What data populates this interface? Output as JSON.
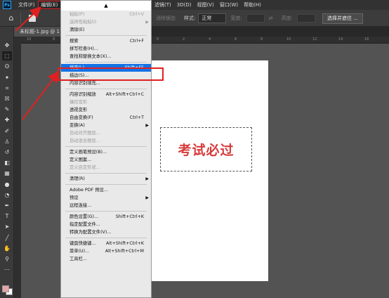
{
  "menubar": {
    "logo": "Ps",
    "items_left": [
      "文件(F)",
      "编辑(E)"
    ],
    "items_right": [
      "滤镜(T)",
      "3D(D)",
      "视图(V)",
      "窗口(W)",
      "帮助(H)"
    ]
  },
  "options": {
    "style_label": "样式:",
    "style_value": "正常",
    "width_label": "宽度:",
    "height_label": "高度:",
    "feather_label": "消除锯齿",
    "select_mask_button": "选择并遮住 ..."
  },
  "document": {
    "tab_title": "未标题-1.jpg @ 1"
  },
  "ruler_ticks": [
    "10",
    "8",
    "6",
    "4",
    "2",
    "0",
    "2",
    "4",
    "6",
    "8",
    "10",
    "12",
    "14",
    "16"
  ],
  "canvas": {
    "text": "考试必过"
  },
  "menu": {
    "top_glyph": "▲",
    "groups": [
      [
        {
          "label": "粘贴(P)",
          "shortcut": "Ctrl+V",
          "disabled": true
        },
        {
          "label": "选择性粘贴(I)",
          "shortcut": "",
          "disabled": true,
          "submenu": true
        },
        {
          "label": "清除(E)",
          "shortcut": "",
          "disabled": false
        }
      ],
      [
        {
          "label": "搜索",
          "shortcut": "Ctrl+F",
          "disabled": false
        },
        {
          "label": "拼写检查(H)...",
          "shortcut": "",
          "disabled": false
        },
        {
          "label": "查找和替换文本(X)...",
          "shortcut": "",
          "disabled": false
        }
      ],
      [
        {
          "label": "填充(L)...",
          "shortcut": "Shift+F5",
          "disabled": false,
          "active": true
        },
        {
          "label": "描边(S)...",
          "shortcut": "",
          "disabled": false
        },
        {
          "label": "内容识别填充...",
          "shortcut": "",
          "disabled": false
        }
      ],
      [
        {
          "label": "内容识别缩放",
          "shortcut": "Alt+Shift+Ctrl+C",
          "disabled": false
        },
        {
          "label": "操控变形",
          "shortcut": "",
          "disabled": true
        },
        {
          "label": "透视变形",
          "shortcut": "",
          "disabled": false
        },
        {
          "label": "自由变换(F)",
          "shortcut": "Ctrl+T",
          "disabled": false
        },
        {
          "label": "变换(A)",
          "shortcut": "",
          "disabled": false,
          "submenu": true
        },
        {
          "label": "自动对齐图层...",
          "shortcut": "",
          "disabled": true
        },
        {
          "label": "自动混合图层...",
          "shortcut": "",
          "disabled": true
        }
      ],
      [
        {
          "label": "定义画笔预设(B)...",
          "shortcut": "",
          "disabled": false
        },
        {
          "label": "定义图案...",
          "shortcut": "",
          "disabled": false
        },
        {
          "label": "定义自定形状...",
          "shortcut": "",
          "disabled": true
        }
      ],
      [
        {
          "label": "清理(R)",
          "shortcut": "",
          "disabled": false,
          "submenu": true
        }
      ],
      [
        {
          "label": "Adobe PDF 预设...",
          "shortcut": "",
          "disabled": false
        },
        {
          "label": "预设",
          "shortcut": "",
          "disabled": false,
          "submenu": true
        },
        {
          "label": "远程连接...",
          "shortcut": "",
          "disabled": false
        }
      ],
      [
        {
          "label": "颜色设置(G)...",
          "shortcut": "Shift+Ctrl+K",
          "disabled": false
        },
        {
          "label": "指定配置文件...",
          "shortcut": "",
          "disabled": false
        },
        {
          "label": "转换为配置文件(V)...",
          "shortcut": "",
          "disabled": false
        }
      ],
      [
        {
          "label": "键盘快捷键...",
          "shortcut": "Alt+Shift+Ctrl+K",
          "disabled": false
        },
        {
          "label": "菜单(U)...",
          "shortcut": "Alt+Shift+Ctrl+M",
          "disabled": false
        },
        {
          "label": "工具栏...",
          "shortcut": "",
          "disabled": false
        }
      ]
    ]
  },
  "tools": [
    "move-tool-icon",
    "marquee-tool-icon",
    "lasso-tool-icon",
    "magic-wand-icon",
    "crop-tool-icon",
    "frame-tool-icon",
    "eyedropper-icon",
    "healing-brush-icon",
    "brush-tool-icon",
    "clone-stamp-icon",
    "history-brush-icon",
    "eraser-icon",
    "gradient-icon",
    "blur-icon",
    "dodge-icon",
    "pen-tool-icon",
    "type-tool-icon",
    "path-select-icon",
    "line-tool-icon",
    "hand-tool-icon",
    "zoom-tool-icon",
    "more-tools-icon"
  ],
  "colors": {
    "accent_red": "#e02020",
    "highlight_blue": "#1473e6",
    "foreground": "#e7a3a8",
    "background": "#ffffff"
  }
}
